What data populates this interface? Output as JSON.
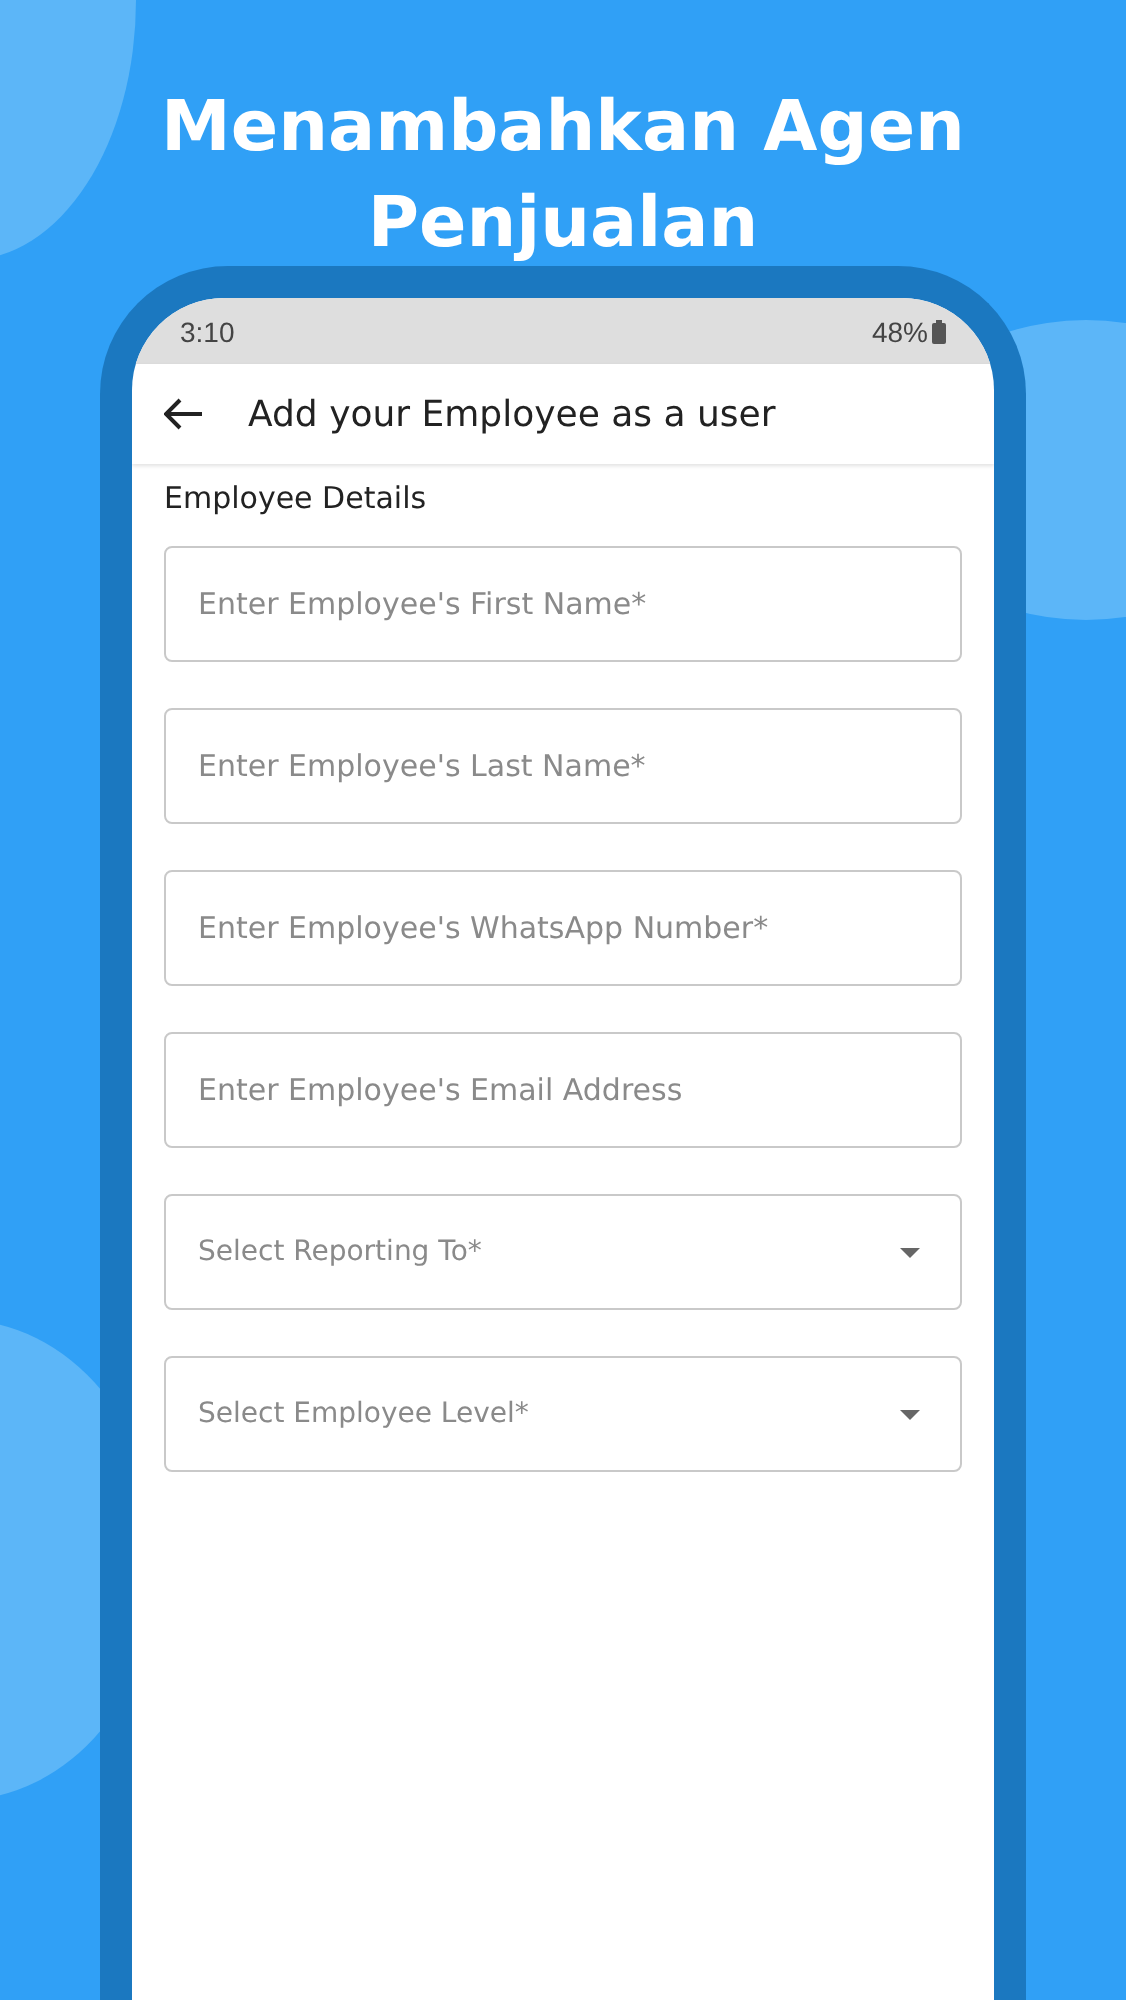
{
  "headline": "Menambahkan Agen Penjualan",
  "status_bar": {
    "time": "3:10",
    "battery": "48%"
  },
  "app_bar": {
    "title": "Add your Employee as a user"
  },
  "section_title": "Employee Details",
  "fields": [
    {
      "kind": "input",
      "placeholder": "Enter Employee's First Name*"
    },
    {
      "kind": "input",
      "placeholder": "Enter Employee's Last Name*"
    },
    {
      "kind": "input",
      "placeholder": "Enter Employee's WhatsApp Number*"
    },
    {
      "kind": "input",
      "placeholder": "Enter Employee's Email Address"
    },
    {
      "kind": "dropdown",
      "placeholder": "Select Reporting To*"
    },
    {
      "kind": "dropdown",
      "placeholder": "Select Employee Level*"
    }
  ]
}
